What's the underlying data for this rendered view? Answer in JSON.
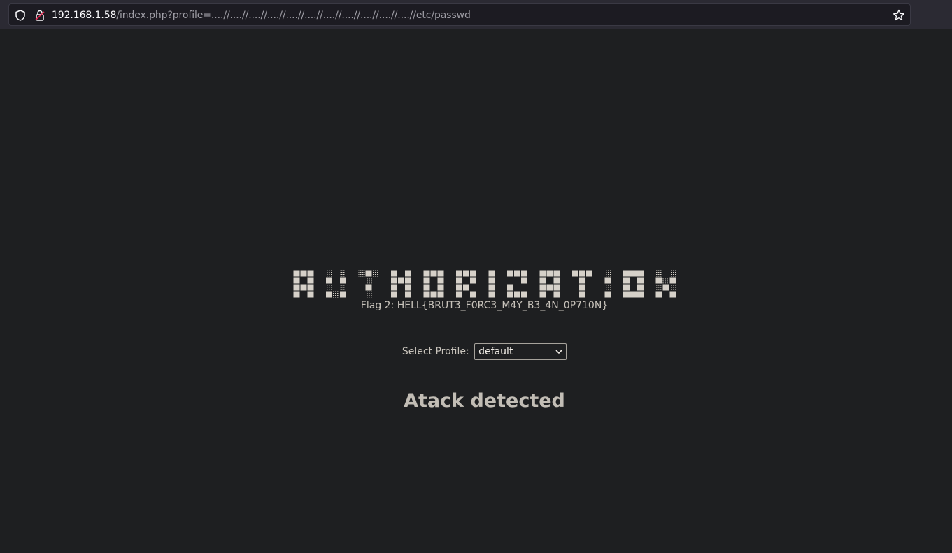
{
  "browser": {
    "url_host": "192.168.1.58",
    "url_path": "/index.php?profile=....//....//....//....//....//....//....//....//....//....//....//etc/passwd",
    "icons": [
      "shield-icon",
      "lock-icon",
      "star-icon"
    ]
  },
  "page": {
    "banner_text": "AUTHORIZATION",
    "flag_text": "Flag 2: HELL{BRUT3_F0RC3_M4Y_B3_4N_0P710N}",
    "profile_label": "Select Profile:",
    "profile_selected": "default",
    "alert_text": "Atack detected"
  },
  "colors": {
    "background": "#1e1f21",
    "text": "#c8c3bb",
    "banner_block": "#d6d1c9"
  }
}
